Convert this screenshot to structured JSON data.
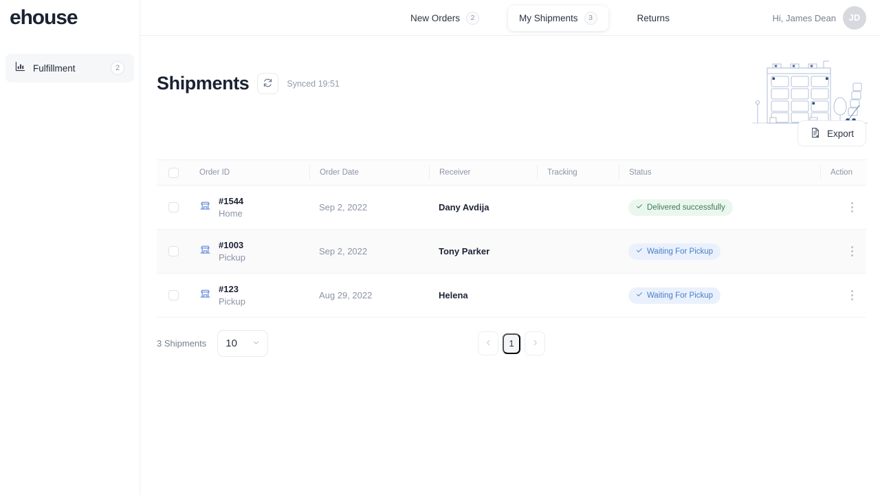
{
  "brand": {
    "name": "ehouse"
  },
  "sidebar": {
    "items": [
      {
        "label": "Fulfillment",
        "badge": "2",
        "icon": "bar-chart-icon",
        "active": true
      }
    ]
  },
  "topnav": {
    "items": [
      {
        "label": "New Orders",
        "badge": "2",
        "active": false
      },
      {
        "label": "My Shipments",
        "badge": "3",
        "active": true
      },
      {
        "label": "Returns",
        "badge": "",
        "active": false
      }
    ],
    "user": {
      "greeting": "Hi, James Dean",
      "initials": "JD"
    }
  },
  "header": {
    "title": "Shipments",
    "sync_status": "Synced 19:51",
    "sync_icon": "refresh-icon"
  },
  "toolbar": {
    "export_label": "Export",
    "export_icon": "document-export-icon"
  },
  "table": {
    "columns": [
      "Order ID",
      "Order Date",
      "Receiver",
      "Tracking",
      "Status",
      "Action"
    ],
    "rows": [
      {
        "order_id": "#1544",
        "order_type": "Home",
        "order_date": "Sep 2, 2022",
        "receiver": "Dany Avdija",
        "tracking": "",
        "status": "Delivered successfully",
        "status_tone": "green"
      },
      {
        "order_id": "#1003",
        "order_type": "Pickup",
        "order_date": "Sep 2, 2022",
        "receiver": "Tony Parker",
        "tracking": "",
        "status": "Waiting For Pickup",
        "status_tone": "blue"
      },
      {
        "order_id": "#123",
        "order_type": "Pickup",
        "order_date": "Aug 29, 2022",
        "receiver": "Helena",
        "tracking": "",
        "status": "Waiting For Pickup",
        "status_tone": "blue"
      }
    ]
  },
  "footer": {
    "count_text": "3 Shipments",
    "per_page_value": "10",
    "page_current": "1"
  },
  "colors": {
    "accent_blue": "#4a7dc4",
    "status_green_bg": "#eaf7ef",
    "status_green_fg": "#3f7a54",
    "status_blue_bg": "#eaf1fd",
    "status_blue_fg": "#4a7dc4",
    "text_dark": "#1b2233",
    "text_muted": "#8b93a4"
  }
}
